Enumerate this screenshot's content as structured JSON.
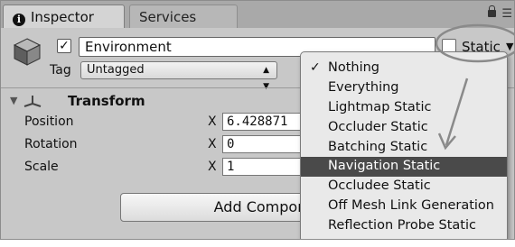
{
  "tabs": [
    {
      "label": "Inspector"
    },
    {
      "label": "Services"
    }
  ],
  "object": {
    "name": "Environment",
    "active": true,
    "static_label": "Static",
    "tag_label": "Tag",
    "tag_value": "Untagged"
  },
  "transform": {
    "title": "Transform",
    "properties": [
      {
        "label": "Position",
        "axis": "X",
        "value": "6.428871"
      },
      {
        "label": "Rotation",
        "axis": "X",
        "value": "0"
      },
      {
        "label": "Scale",
        "axis": "X",
        "value": "1"
      }
    ]
  },
  "add_component_label": "Add Compon",
  "static_dropdown": {
    "items": [
      {
        "label": "Nothing",
        "checked": true
      },
      {
        "label": "Everything"
      },
      {
        "label": "Lightmap Static"
      },
      {
        "label": "Occluder Static"
      },
      {
        "label": "Batching Static"
      },
      {
        "label": "Navigation Static",
        "highlighted": true
      },
      {
        "label": "Occludee Static"
      },
      {
        "label": "Off Mesh Link Generation"
      },
      {
        "label": "Reflection Probe Static"
      }
    ],
    "check_glyph": "✓"
  },
  "icons": {
    "info": "info-icon",
    "lock": "lock-icon",
    "menu": "menu-icon",
    "cube": "cube-icon",
    "transform": "transform-icon"
  },
  "colors": {
    "highlight": "#4a4a4a",
    "panel": "#c8c8c8",
    "annotation": "#8a8a8a"
  }
}
